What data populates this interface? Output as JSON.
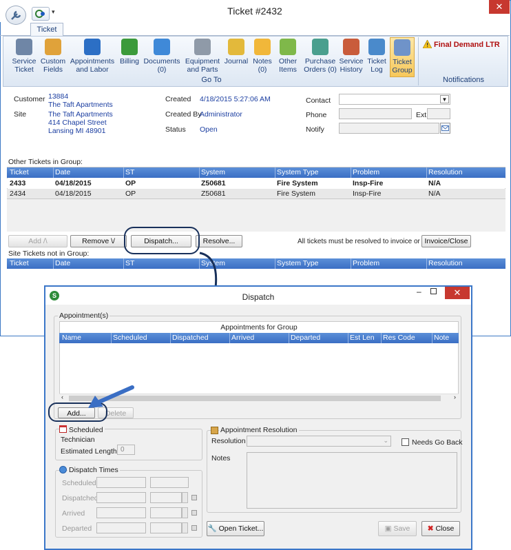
{
  "window": {
    "title": "Ticket #2432",
    "tab_label": "Ticket",
    "close_glyph": "✕"
  },
  "ribbon": {
    "buttons": [
      {
        "label": "Service Ticket",
        "icon": "wrench-icon"
      },
      {
        "label": "Custom Fields",
        "icon": "custom-fields-icon"
      },
      {
        "label": "Appointments and Labor",
        "icon": "alarm-clock-icon"
      },
      {
        "label": "Billing",
        "icon": "dollar-icon"
      },
      {
        "label": "Documents (0)",
        "icon": "document-icon"
      },
      {
        "label": "Equipment and Parts",
        "icon": "equipment-icon"
      },
      {
        "label": "Journal",
        "icon": "journal-icon"
      },
      {
        "label": "Notes (0)",
        "icon": "notes-icon"
      },
      {
        "label": "Other Items",
        "icon": "tag-icon"
      },
      {
        "label": "Purchase Orders (0)",
        "icon": "purchase-orders-icon"
      },
      {
        "label": "Service History",
        "icon": "history-icon"
      },
      {
        "label": "Ticket Log",
        "icon": "log-icon"
      },
      {
        "label": "Ticket Group",
        "icon": "ticket-group-icon"
      }
    ],
    "goto_label": "Go To",
    "notifications_label": "Notifications",
    "notification_text": "Final Demand LTR"
  },
  "info": {
    "customer_label": "Customer",
    "customer_number": "13884",
    "customer_name": "The Taft Apartments",
    "site_label": "Site",
    "site_name": "The Taft Apartments",
    "site_address1": "414 Chapel Street",
    "site_address2": "Lansing MI 48901",
    "created_label": "Created",
    "created_value": "4/18/2015 5:27:06 AM",
    "created_by_label": "Created By",
    "created_by_value": "Administrator",
    "status_label": "Status",
    "status_value": "Open",
    "contact_label": "Contact",
    "phone_label": "Phone",
    "ext_label": "Ext",
    "notify_label": "Notify"
  },
  "other_tickets": {
    "title": "Other Tickets in Group:",
    "columns": [
      "Ticket",
      "Date",
      "ST",
      "System",
      "System Type",
      "Problem",
      "Resolution"
    ],
    "rows": [
      [
        "2433",
        "04/18/2015",
        "OP",
        "Z50681",
        "Fire System",
        "Insp-Fire",
        "N/A"
      ],
      [
        "2434",
        "04/18/2015",
        "OP",
        "Z50681",
        "Fire System",
        "Insp-Fire",
        "N/A"
      ]
    ]
  },
  "actions": {
    "add": "Add /\\",
    "remove": "Remove \\/",
    "dispatch": "Dispatch...",
    "resolve": "Resolve...",
    "note": "All tickets must be resolved to invoice or close",
    "invoice_close": "Invoice/Close"
  },
  "site_tickets": {
    "title": "Site Tickets not in Group:",
    "columns": [
      "Ticket",
      "Date",
      "ST",
      "System",
      "System Type",
      "Problem",
      "Resolution"
    ]
  },
  "dispatch": {
    "title": "Dispatch",
    "appointments_label": "Appointment(s)",
    "grid_caption": "Appointments for Group",
    "columns": [
      "Name",
      "Scheduled",
      "Dispatched",
      "Arrived",
      "Departed",
      "Est Len",
      "Res Code",
      "Note"
    ],
    "add": "Add...",
    "delete": "Delete",
    "scheduled_label": "Scheduled",
    "technician_label": "Technician",
    "estimated_length_label": "Estimated Length",
    "estimated_length_value": "0",
    "resolution_group_label": "Appointment Resolution",
    "resolution_label": "Resolution",
    "needs_go_back_label": "Needs Go Back",
    "notes_label": "Notes",
    "dispatch_times_label": "Dispatch Times",
    "times": [
      "Scheduled",
      "Dispatched",
      "Arrived",
      "Departed"
    ],
    "open_ticket": "Open Ticket...",
    "save": "Save",
    "close": "Close"
  }
}
